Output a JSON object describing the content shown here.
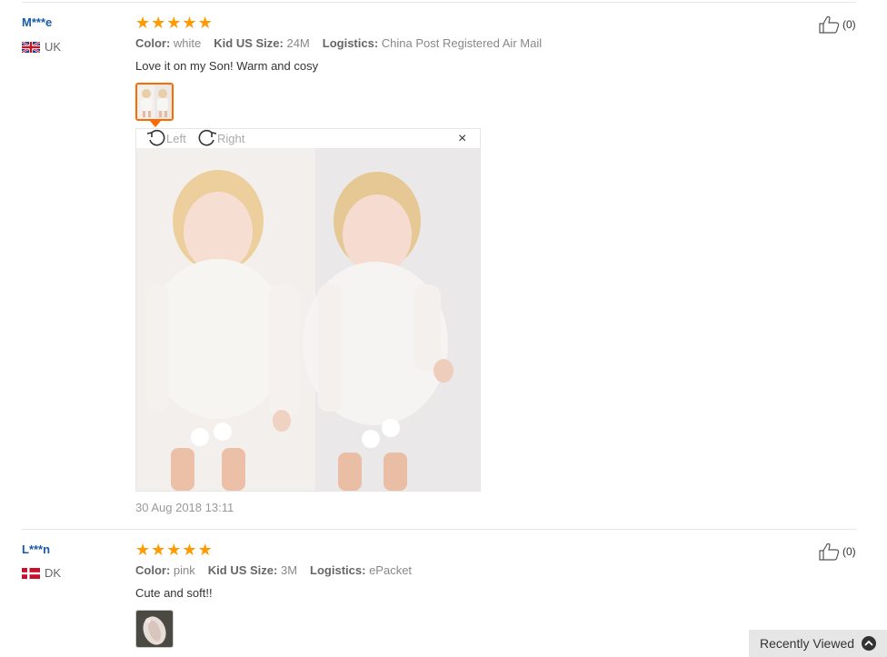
{
  "reviews": [
    {
      "user": "M***e",
      "country": "UK",
      "stars": [
        "★",
        "★",
        "★",
        "★",
        "★"
      ],
      "attributes": [
        {
          "label": "Color:",
          "value": "white"
        },
        {
          "label": "Kid US Size:",
          "value": "24M"
        },
        {
          "label": "Logistics:",
          "value": "China Post Registered Air Mail"
        }
      ],
      "comment": "Love it on my Son! Warm and cosy",
      "likes": "(0)",
      "date": "30 Aug 2018 13:11"
    },
    {
      "user": "L***n",
      "country": "DK",
      "stars": [
        "★",
        "★",
        "★",
        "★",
        "★"
      ],
      "attributes": [
        {
          "label": "Color:",
          "value": "pink"
        },
        {
          "label": "Kid US Size:",
          "value": "3M"
        },
        {
          "label": "Logistics:",
          "value": "ePacket"
        }
      ],
      "comment": "Cute and soft!!",
      "likes": "(0)"
    }
  ],
  "viewer": {
    "rotate_left": "Left",
    "rotate_right": "Right",
    "close": "×"
  },
  "recently_viewed": "Recently Viewed",
  "colors": {
    "accent": "#ff6a00",
    "star": "#ff9a00",
    "username": "#1a5aa8"
  },
  "icons": {
    "like": "thumbs-up-icon",
    "rotate_left": "rotate-left-icon",
    "rotate_right": "rotate-right-icon",
    "close": "close-icon",
    "recent": "chevron-up-icon"
  }
}
